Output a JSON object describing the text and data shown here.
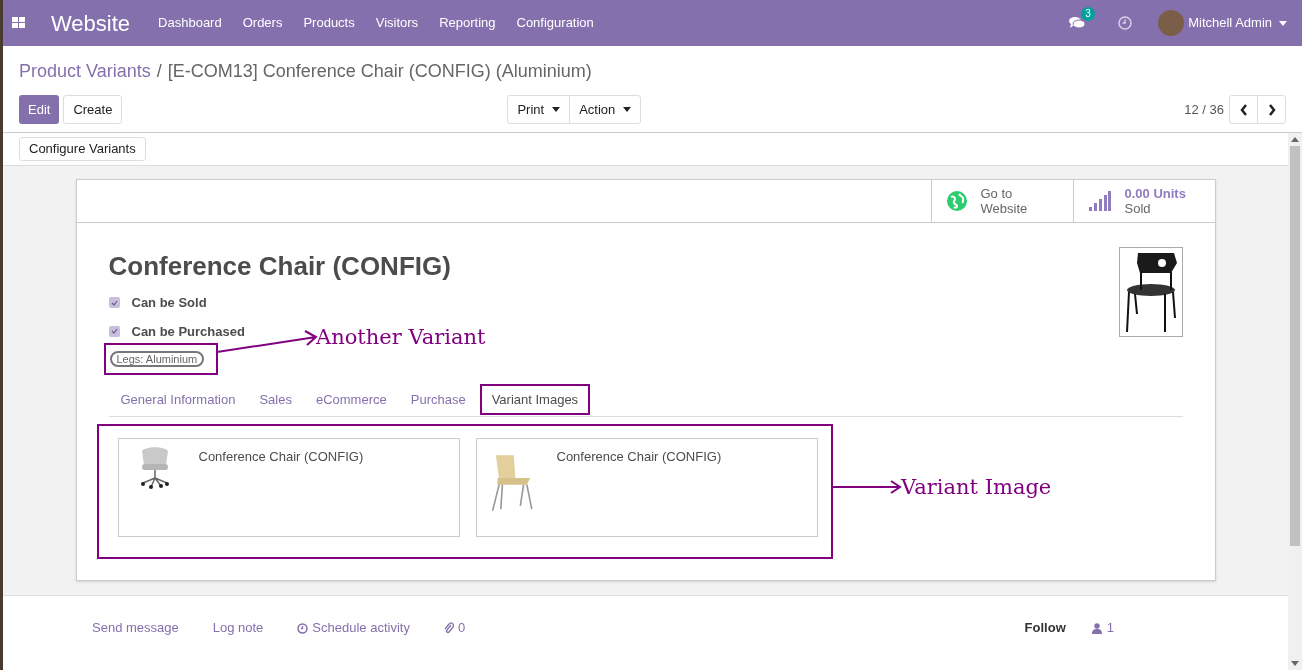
{
  "navbar": {
    "app_name": "Website",
    "menu": [
      "Dashboard",
      "Orders",
      "Products",
      "Visitors",
      "Reporting",
      "Configuration"
    ],
    "messages_badge": "3",
    "user": "Mitchell Admin"
  },
  "breadcrumb": {
    "parent": "Product Variants",
    "separator": "/",
    "current": "[E-COM13] Conference Chair (CONFIG) (Aluminium)"
  },
  "actions": [
    {
      "label": "Edit",
      "kind": "primary"
    },
    {
      "label": "Create",
      "kind": "secondary"
    }
  ],
  "dropdowns": [
    "Print",
    "Action"
  ],
  "pager": "12 / 36",
  "status_buttons": [
    "Configure Variants"
  ],
  "sheet": {
    "stat_buttons": [
      {
        "kind": "website",
        "line1": "Go to",
        "line2": "Website"
      },
      {
        "kind": "sales",
        "line1": "0.00 Units",
        "line2": "Sold"
      }
    ],
    "title": "Conference Chair (CONFIG)",
    "checkboxes": [
      {
        "label": "Can be Sold",
        "checked": true
      },
      {
        "label": "Can be Purchased",
        "checked": true
      }
    ],
    "tag": {
      "label": "Legs: Aluminium",
      "highlighted": true
    },
    "tabs": [
      {
        "label": "General Information",
        "selected": false,
        "highlighted": false
      },
      {
        "label": "Sales",
        "selected": false,
        "highlighted": false
      },
      {
        "label": "eCommerce",
        "selected": false,
        "highlighted": false
      },
      {
        "label": "Purchase",
        "selected": false,
        "highlighted": false
      },
      {
        "label": "Variant Images",
        "selected": true,
        "highlighted": true
      }
    ],
    "variant_images": {
      "highlighted": true,
      "cards": [
        {
          "name": "Conference Chair (CONFIG)",
          "kind": "swivel"
        },
        {
          "name": "Conference Chair (CONFIG)",
          "kind": "wooden"
        }
      ]
    }
  },
  "chatter": {
    "actions": [
      {
        "label": "Send message",
        "kind": "text"
      },
      {
        "label": "Log note",
        "kind": "text"
      },
      {
        "label": "Schedule activity",
        "kind": "clock"
      },
      {
        "label": "0",
        "kind": "attachment"
      }
    ],
    "follow": "Follow",
    "followers": "1"
  },
  "annotations": [
    {
      "label": "Another Variant"
    },
    {
      "label": "Variant Image"
    }
  ]
}
